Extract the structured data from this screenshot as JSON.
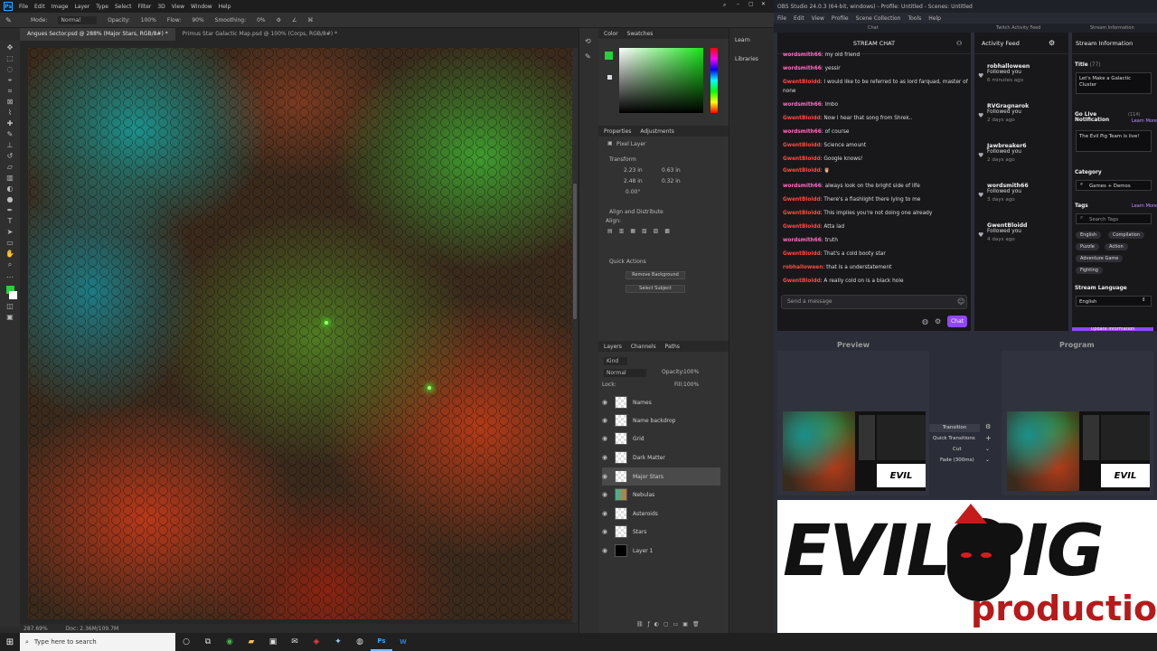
{
  "ps": {
    "menu": [
      "File",
      "Edit",
      "Image",
      "Layer",
      "Type",
      "Select",
      "Filter",
      "3D",
      "View",
      "Window",
      "Help"
    ],
    "options": {
      "mode_label": "Mode:",
      "mode_value": "Normal",
      "opacity_label": "Opacity:",
      "opacity_value": "100%",
      "flow_label": "Flow:",
      "flow_value": "90%",
      "smoothing_label": "Smoothing:",
      "smoothing_value": "0%"
    },
    "tabs": [
      "Angues Sector.psd @ 288% (Major Stars, RGB/8#) *",
      "Primus Star Galactic Map.psd @ 100% (Corps, RGB/8#) *"
    ],
    "status": {
      "zoom": "287.69%",
      "doc": "Doc: 2.36M/109.7M"
    },
    "color_panel": {
      "tab1": "Color",
      "tab2": "Swatches",
      "fg": "#27d13a",
      "bg": "#ffffff"
    },
    "properties": {
      "tab1": "Properties",
      "tab2": "Adjustments",
      "kind": "Pixel Layer",
      "transform": "Transform",
      "w": "2.23 in",
      "x": "0.63 in",
      "h": "2.48 in",
      "y": "0.32 in",
      "angle": "0.00°",
      "align": "Align and Distribute",
      "align_sub": "Align:",
      "quick": "Quick Actions",
      "btn1": "Remove Background",
      "btn2": "Select Subject"
    },
    "layers_panel": {
      "tab1": "Layers",
      "tab2": "Channels",
      "tab3": "Paths",
      "filter": "Kind",
      "blend": "Normal",
      "opacity_label": "Opacity:",
      "opacity": "100%",
      "lock_label": "Lock:",
      "fill_label": "Fill:",
      "fill": "100%",
      "layers": [
        "Names",
        "Name backdrop",
        "Grid",
        "Dark Matter",
        "Major Stars",
        "Nebulas",
        "Asteroids",
        "Stars",
        "Layer 1"
      ]
    },
    "far_panel": [
      "Learn",
      "Libraries"
    ]
  },
  "obs": {
    "title": "OBS Studio 24.0.3 (64-bit, windows) - Profile: Untitled - Scenes: Untitled",
    "menu": [
      "File",
      "Edit",
      "View",
      "Profile",
      "Scene Collection",
      "Tools",
      "Help"
    ],
    "dock_chat": "Chat",
    "dock_activity": "Twitch Activity Feed",
    "dock_info": "Stream Information",
    "chat": {
      "header": "STREAM CHAT",
      "messages": [
        {
          "user": "wordsmith66",
          "text": "my old friend",
          "color": "#ff6ac1"
        },
        {
          "user": "wordsmith66",
          "text": "yessir",
          "color": "#ff6ac1"
        },
        {
          "user": "GwentBloidd",
          "text": "I would like to be referred to as lord farquad, master of",
          "color": "#ff4a3d"
        },
        {
          "user": "",
          "text": "none",
          "color": "#ff4a3d"
        },
        {
          "user": "wordsmith66",
          "text": "lmbo",
          "color": "#ff6ac1"
        },
        {
          "user": "GwentBloidd",
          "text": "Now I hear that song from Shrek..",
          "color": "#ff4a3d"
        },
        {
          "user": "wordsmith66",
          "text": "of course",
          "color": "#ff6ac1"
        },
        {
          "user": "GwentBloidd",
          "text": "Science amount",
          "color": "#ff4a3d"
        },
        {
          "user": "GwentBloidd",
          "text": "Google knows!",
          "color": "#ff4a3d"
        },
        {
          "user": "GwentBloidd",
          "text": "🦉",
          "color": "#ff4a3d"
        },
        {
          "user": "wordsmith66",
          "text": "always look on the bright side of life",
          "color": "#ff6ac1"
        },
        {
          "user": "GwentBloidd",
          "text": "There's a flashlight there lying to me",
          "color": "#ff4a3d"
        },
        {
          "user": "GwentBloidd",
          "text": "This implies you're not doing one already",
          "color": "#ff4a3d"
        },
        {
          "user": "GwentBloidd",
          "text": "Atta lad",
          "color": "#ff4a3d"
        },
        {
          "user": "wordsmith66",
          "text": "truth",
          "color": "#ff6ac1"
        },
        {
          "user": "GwentBloidd",
          "text": "That's a cold booty star",
          "color": "#ff4a3d"
        },
        {
          "user": "robhalloween",
          "text": "that is a understatement",
          "color": "#ff4a3d"
        },
        {
          "user": "GwentBloidd",
          "text": "A really cold on is a black hole",
          "color": "#ff4a3d"
        }
      ],
      "placeholder": "Send a message",
      "send": "Chat"
    },
    "activity": {
      "header": "Activity Feed",
      "items": [
        {
          "name": "robhalloween",
          "action": "Followed you",
          "time": "6 minutes ago"
        },
        {
          "name": "RVGragnarok",
          "action": "Followed you",
          "time": "2 days ago"
        },
        {
          "name": "Jawbreaker6",
          "action": "Followed you",
          "time": "2 days ago"
        },
        {
          "name": "wordsmith66",
          "action": "Followed you",
          "time": "3 days ago"
        },
        {
          "name": "GwentBloidd",
          "action": "Followed you",
          "time": "4 days ago"
        }
      ]
    },
    "info": {
      "header": "Stream Information",
      "title_label": "Title",
      "title_count": "(77)",
      "title": "Let's Make a Galactic Cluster",
      "golive_label": "Go Live Notification",
      "golive_count": "(114)",
      "learn": "Learn More",
      "golive": "The Evil Pig Team is live!",
      "category_label": "Category",
      "category": "Games + Demos",
      "tags_label": "Tags",
      "tags_learn": "Learn More",
      "tags_search": "Search Tags",
      "tags": [
        "English",
        "Compilation",
        "Puzzle",
        "Action",
        "Adventure Game",
        "Fighting"
      ],
      "lang_label": "Stream Language",
      "lang": "English",
      "update": "Update Information"
    },
    "preview_label": "Preview",
    "program_label": "Program",
    "transition": {
      "btn": "Transition",
      "quick": "Quick Transitions",
      "cut": "Cut",
      "fade": "Fade (300ms)"
    },
    "logo": {
      "brand": "EVIL PIG",
      "sub": "production",
      "thumb_brand": "EVIL"
    }
  },
  "taskbar": {
    "search": "Type here to search"
  }
}
